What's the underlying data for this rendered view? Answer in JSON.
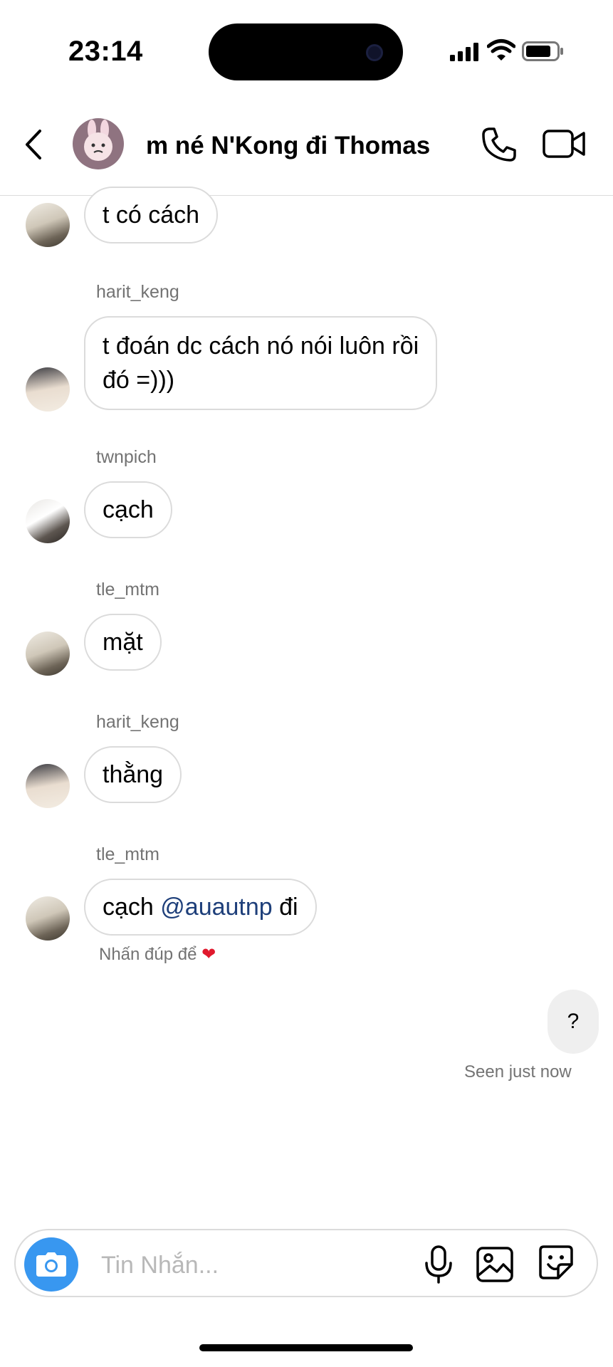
{
  "status_bar": {
    "time": "23:14"
  },
  "header": {
    "title": "m né N'Kong đi Thomas"
  },
  "messages": [
    {
      "sender": "",
      "text": "t có cách"
    },
    {
      "sender": "harit_keng",
      "line1": "t đoán dc cách nó nói luôn rồi",
      "line2": "đó =)))"
    },
    {
      "sender": "twnpich",
      "text": "cạch"
    },
    {
      "sender": "tle_mtm",
      "text": "mặt"
    },
    {
      "sender": "harit_keng",
      "text": "thằng"
    },
    {
      "sender": "tle_mtm",
      "before": "cạch ",
      "mention": "@auautnp",
      "after": " đi"
    }
  ],
  "double_tap_hint": "Nhấn đúp để",
  "my_message": {
    "text": "?",
    "status": "Seen just now"
  },
  "composer": {
    "placeholder": "Tin Nhắn..."
  },
  "colors": {
    "accent": "#3897f0",
    "mention": "#1e3f7a",
    "heart": "#e0192d"
  }
}
